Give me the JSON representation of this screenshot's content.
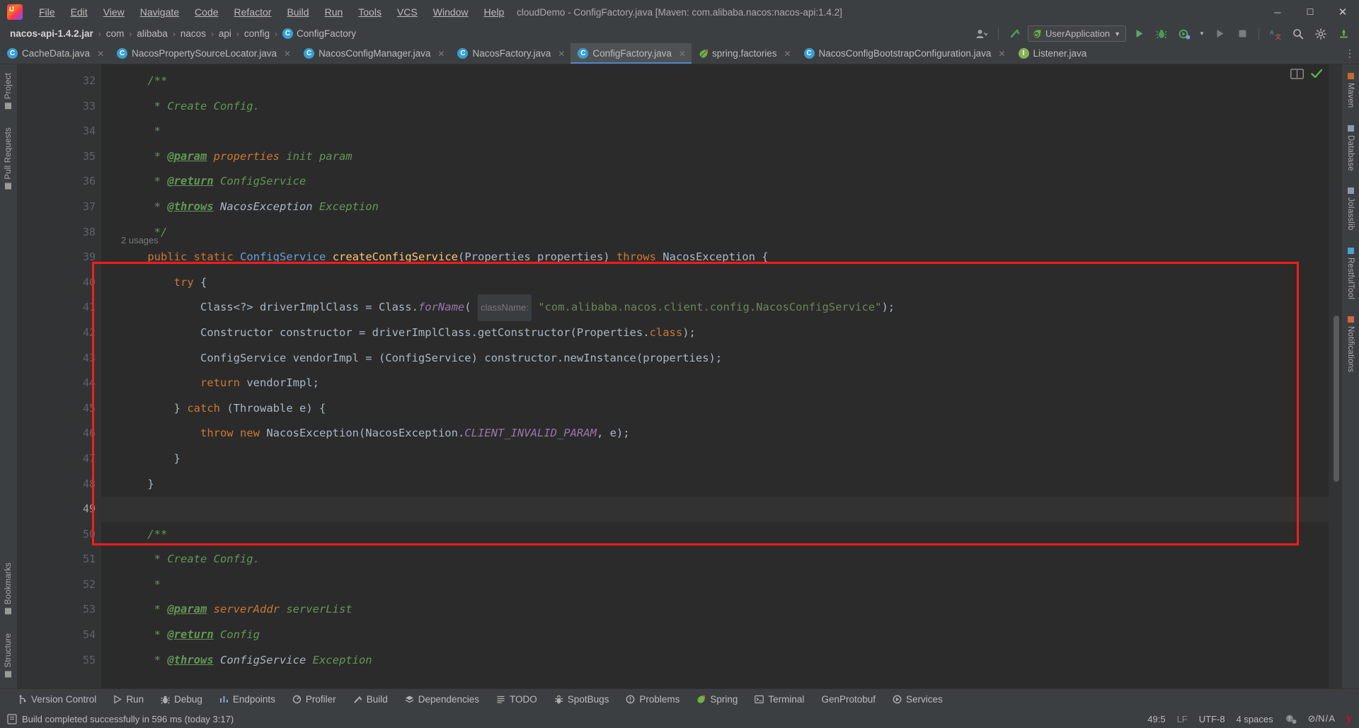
{
  "window": {
    "title": "cloudDemo - ConfigFactory.java [Maven: com.alibaba.nacos:nacos-api:1.4.2]",
    "minimize": "—",
    "maximize": "❐",
    "close": "✕",
    "logo_text": "IJ"
  },
  "menubar": [
    {
      "label": "File"
    },
    {
      "label": "Edit"
    },
    {
      "label": "View"
    },
    {
      "label": "Navigate"
    },
    {
      "label": "Code"
    },
    {
      "label": "Refactor"
    },
    {
      "label": "Build"
    },
    {
      "label": "Run"
    },
    {
      "label": "Tools"
    },
    {
      "label": "VCS"
    },
    {
      "label": "Window"
    },
    {
      "label": "Help"
    }
  ],
  "breadcrumb": {
    "items": [
      {
        "label": "nacos-api-1.4.2.jar",
        "bold": true
      },
      {
        "label": "com",
        "bold": false
      },
      {
        "label": "alibaba",
        "bold": false
      },
      {
        "label": "nacos",
        "bold": false
      },
      {
        "label": "api",
        "bold": false
      },
      {
        "label": "config",
        "bold": false
      },
      {
        "label": "ConfigFactory",
        "bold": false,
        "badge": "C"
      }
    ],
    "separator": "›"
  },
  "toolbar": {
    "run_config": "UserApplication",
    "run_config_caret": "▼",
    "user_caret": "▼",
    "run_label": "Run",
    "debug_label": "Debug",
    "coverage_label": "Run with Coverage",
    "profiler_caret": "▾",
    "build_label": "Build Project",
    "stop_label": "Stop",
    "translate_label": "Translate",
    "search_label": "Search Everywhere",
    "settings_label": "Settings",
    "updates_label": "Updates"
  },
  "tabs": [
    {
      "label": "CacheData.java",
      "icon": "java-class-icon",
      "active": false,
      "close": "✕"
    },
    {
      "label": "NacosPropertySourceLocator.java",
      "icon": "java-class-icon",
      "active": false,
      "close": "✕"
    },
    {
      "label": "NacosConfigManager.java",
      "icon": "java-class-icon",
      "active": false,
      "close": "✕"
    },
    {
      "label": "NacosFactory.java",
      "icon": "java-class-icon",
      "active": false,
      "close": "✕"
    },
    {
      "label": "ConfigFactory.java",
      "icon": "java-class-icon",
      "active": true,
      "close": "✕"
    },
    {
      "label": "spring.factories",
      "icon": "spring-leaf-icon",
      "active": false,
      "close": "✕"
    },
    {
      "label": "NacosConfigBootstrapConfiguration.java",
      "icon": "java-class-icon",
      "active": false,
      "close": "✕"
    },
    {
      "label": "Listener.java",
      "icon": "java-interface-icon",
      "active": false,
      "close": "✕"
    }
  ],
  "tabs_overflow": "⋮",
  "left_strip": [
    {
      "label": "Project"
    },
    {
      "label": "Pull Requests"
    },
    {
      "label": "Bookmarks"
    },
    {
      "label": "Structure"
    }
  ],
  "right_strip": [
    {
      "label": "Maven"
    },
    {
      "label": "Database"
    },
    {
      "label": "JoIasslib"
    },
    {
      "label": "RestfulTool"
    },
    {
      "label": "Notifications"
    }
  ],
  "editor": {
    "first_line": 32,
    "usages_hint": "2 usages",
    "param_hint_classname": "className:",
    "lines": [
      {
        "n": 32,
        "fold": "minus",
        "segments": [
          {
            "t": "    ",
            "c": "plain"
          },
          {
            "t": "/**",
            "c": "cmt"
          }
        ]
      },
      {
        "n": 33,
        "segments": [
          {
            "t": "     * Create Config.",
            "c": "cmt"
          }
        ]
      },
      {
        "n": 34,
        "segments": [
          {
            "t": "     *",
            "c": "cmt"
          }
        ]
      },
      {
        "n": 35,
        "segments": [
          {
            "t": "     * ",
            "c": "cmt"
          },
          {
            "t": "@param",
            "c": "tag"
          },
          {
            "t": " properties",
            "c": "tagarg"
          },
          {
            "t": " init param",
            "c": "cmt"
          }
        ]
      },
      {
        "n": 36,
        "segments": [
          {
            "t": "     * ",
            "c": "cmt"
          },
          {
            "t": "@return",
            "c": "tag"
          },
          {
            "t": " ConfigService",
            "c": "cmt"
          }
        ]
      },
      {
        "n": 37,
        "segments": [
          {
            "t": "     * ",
            "c": "cmt"
          },
          {
            "t": "@throws",
            "c": "tag"
          },
          {
            "t": " NacosException",
            "c": "typ"
          },
          {
            "t": " Exception",
            "c": "cmt"
          }
        ]
      },
      {
        "n": 38,
        "fold": "minus",
        "segments": [
          {
            "t": "     */",
            "c": "cmt"
          }
        ]
      },
      {
        "n": 39,
        "fold": "minus",
        "usages": true,
        "segments": [
          {
            "t": "    ",
            "c": "plain"
          },
          {
            "t": "public",
            "c": "kw"
          },
          {
            "t": " ",
            "c": "plain"
          },
          {
            "t": "static",
            "c": "kw"
          },
          {
            "t": " ",
            "c": "plain"
          },
          {
            "t": "ConfigService",
            "c": "blue"
          },
          {
            "t": " ",
            "c": "plain"
          },
          {
            "t": "createConfigService",
            "c": "mth"
          },
          {
            "t": "(Properties properties) ",
            "c": "typ"
          },
          {
            "t": "throws",
            "c": "kw"
          },
          {
            "t": " NacosException {",
            "c": "typ"
          }
        ]
      },
      {
        "n": 40,
        "fold": "minus",
        "segments": [
          {
            "t": "        ",
            "c": "plain"
          },
          {
            "t": "try",
            "c": "kw"
          },
          {
            "t": " {",
            "c": "typ"
          }
        ]
      },
      {
        "n": 41,
        "segments": [
          {
            "t": "            Class<?> driverImplClass = Class.",
            "c": "typ"
          },
          {
            "t": "forName",
            "c": "stc"
          },
          {
            "t": "( ",
            "c": "typ"
          },
          {
            "t": "className:",
            "c": "inlay"
          },
          {
            "t": " ",
            "c": "typ"
          },
          {
            "t": "\"com.alibaba.nacos.client.config.NacosConfigService\"",
            "c": "str"
          },
          {
            "t": ");",
            "c": "typ"
          }
        ]
      },
      {
        "n": 42,
        "segments": [
          {
            "t": "            Constructor constructor = driverImplClass.getConstructor(Properties.",
            "c": "typ"
          },
          {
            "t": "class",
            "c": "kw"
          },
          {
            "t": ");",
            "c": "typ"
          }
        ]
      },
      {
        "n": 43,
        "segments": [
          {
            "t": "            ConfigService vendorImpl = (ConfigService) constructor.newInstance(properties);",
            "c": "typ"
          }
        ]
      },
      {
        "n": 44,
        "segments": [
          {
            "t": "            ",
            "c": "plain"
          },
          {
            "t": "return",
            "c": "kw"
          },
          {
            "t": " vendorImpl;",
            "c": "typ"
          }
        ]
      },
      {
        "n": 45,
        "fold": "minus",
        "segments": [
          {
            "t": "        } ",
            "c": "typ"
          },
          {
            "t": "catch",
            "c": "kw"
          },
          {
            "t": " (Throwable e) {",
            "c": "typ"
          }
        ]
      },
      {
        "n": 46,
        "segments": [
          {
            "t": "            ",
            "c": "plain"
          },
          {
            "t": "throw",
            "c": "kw"
          },
          {
            "t": " ",
            "c": "plain"
          },
          {
            "t": "new",
            "c": "kw"
          },
          {
            "t": " NacosException(NacosException.",
            "c": "typ"
          },
          {
            "t": "CLIENT_INVALID_PARAM",
            "c": "fld"
          },
          {
            "t": ", e);",
            "c": "typ"
          }
        ]
      },
      {
        "n": 47,
        "fold": "minus",
        "segments": [
          {
            "t": "        }",
            "c": "typ"
          }
        ]
      },
      {
        "n": 48,
        "fold": "minus",
        "segments": [
          {
            "t": "    }",
            "c": "typ"
          }
        ]
      },
      {
        "n": 49,
        "current": true,
        "segments": [
          {
            "t": "",
            "c": "plain"
          }
        ]
      },
      {
        "n": 50,
        "fold": "minus",
        "segments": [
          {
            "t": "    ",
            "c": "plain"
          },
          {
            "t": "/**",
            "c": "cmt"
          }
        ]
      },
      {
        "n": 51,
        "segments": [
          {
            "t": "     * Create Config.",
            "c": "cmt"
          }
        ]
      },
      {
        "n": 52,
        "segments": [
          {
            "t": "     *",
            "c": "cmt"
          }
        ]
      },
      {
        "n": 53,
        "segments": [
          {
            "t": "     * ",
            "c": "cmt"
          },
          {
            "t": "@param",
            "c": "tag"
          },
          {
            "t": " serverAddr",
            "c": "tagarg"
          },
          {
            "t": " serverList",
            "c": "cmt"
          }
        ]
      },
      {
        "n": 54,
        "segments": [
          {
            "t": "     * ",
            "c": "cmt"
          },
          {
            "t": "@return",
            "c": "tag"
          },
          {
            "t": " Config",
            "c": "cmt"
          }
        ]
      },
      {
        "n": 55,
        "segments": [
          {
            "t": "     * ",
            "c": "cmt"
          },
          {
            "t": "@throws",
            "c": "tag"
          },
          {
            "t": " ConfigService",
            "c": "typ"
          },
          {
            "t": " Exception",
            "c": "cmt"
          }
        ]
      }
    ]
  },
  "bottom_tools": [
    {
      "label": "Version Control",
      "icon": "branch-icon"
    },
    {
      "label": "Run",
      "icon": "play-icon"
    },
    {
      "label": "Debug",
      "icon": "bug-icon"
    },
    {
      "label": "Endpoints",
      "icon": "endpoints-icon"
    },
    {
      "label": "Profiler",
      "icon": "profiler-icon"
    },
    {
      "label": "Build",
      "icon": "hammer-icon"
    },
    {
      "label": "Dependencies",
      "icon": "layers-icon"
    },
    {
      "label": "TODO",
      "icon": "list-icon"
    },
    {
      "label": "SpotBugs",
      "icon": "spotbugs-icon"
    },
    {
      "label": "Problems",
      "icon": "problems-icon"
    },
    {
      "label": "Spring",
      "icon": "spring-leaf-icon"
    },
    {
      "label": "Terminal",
      "icon": "terminal-icon"
    },
    {
      "label": "GenProtobuf",
      "icon": "protobuf-icon"
    },
    {
      "label": "Services",
      "icon": "services-icon"
    }
  ],
  "statusbar": {
    "message": "Build completed successfully in 596 ms (today 3:17)",
    "caret": "49:5",
    "line_separator": "LF",
    "encoding": "UTF-8",
    "indent": "4 spaces",
    "inspection": "⊘/N / A",
    "yandex": "y"
  },
  "colors": {
    "accent": "#4a88c7",
    "annotation_rect": "#ff1a1a",
    "success": "#62b543",
    "class_icon": "#389fd6",
    "keyword": "#cc7832",
    "string": "#6a8759",
    "comment": "#629755",
    "method": "#ffc66d",
    "field": "#9876aa"
  }
}
